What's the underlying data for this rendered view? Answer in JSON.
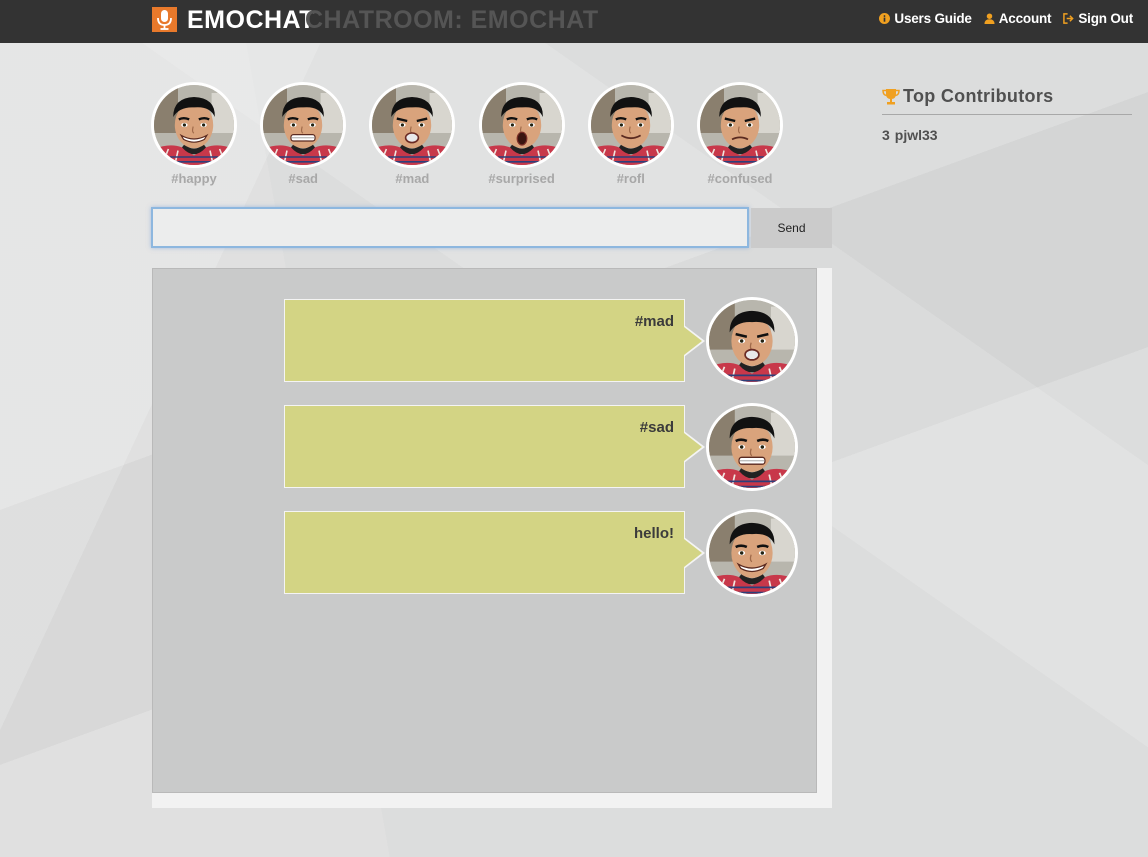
{
  "header": {
    "brand": "EMOCHAT",
    "chatroom_label": "CHATROOM: EMOCHAT",
    "logo_icon": "microphone-logo-icon",
    "nav": [
      {
        "label": "Users Guide",
        "icon": "info-icon"
      },
      {
        "label": "Account",
        "icon": "user-icon"
      },
      {
        "label": "Sign Out",
        "icon": "sign-out-icon"
      }
    ],
    "accent_color": "#f0a020"
  },
  "emotions": [
    {
      "tag": "#happy",
      "expression": "grin"
    },
    {
      "tag": "#sad",
      "expression": "grimace"
    },
    {
      "tag": "#mad",
      "expression": "pout"
    },
    {
      "tag": "#surprised",
      "expression": "open-mouth"
    },
    {
      "tag": "#rofl",
      "expression": "smile"
    },
    {
      "tag": "#confused",
      "expression": "frown"
    }
  ],
  "composer": {
    "input_value": "",
    "send_label": "Send"
  },
  "messages": [
    {
      "text": "#mad",
      "expression": "pout"
    },
    {
      "text": "#sad",
      "expression": "grimace"
    },
    {
      "text": "hello!",
      "expression": "grin"
    }
  ],
  "sidebar": {
    "title": "Top Contributors",
    "icon": "trophy-icon",
    "contributors": [
      {
        "count": "3",
        "name": "pjwl33"
      }
    ]
  },
  "colors": {
    "topbar": "#333333",
    "bubble": "#d3d484",
    "logo": "#e8792b"
  }
}
